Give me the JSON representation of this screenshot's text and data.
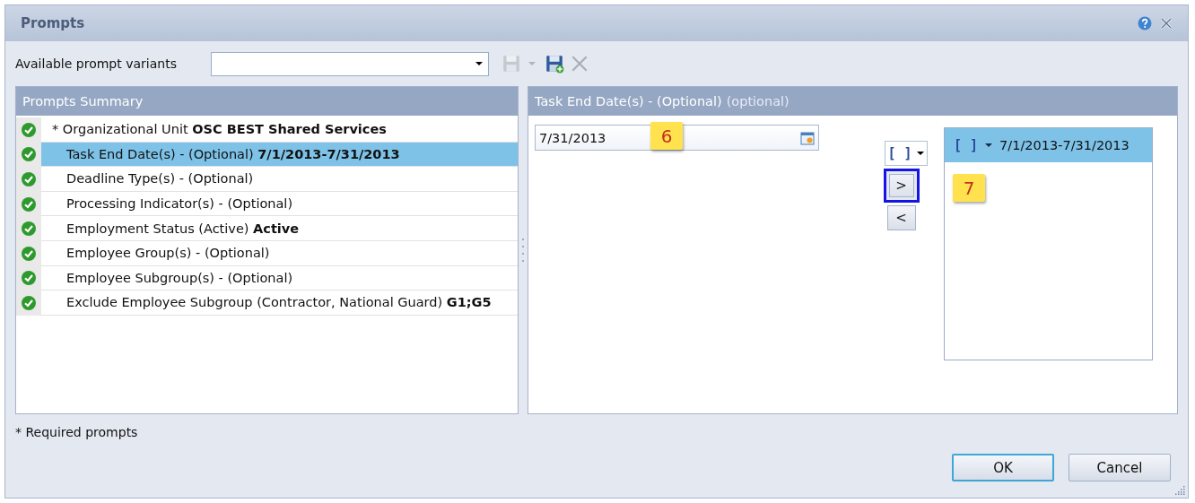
{
  "window": {
    "title": "Prompts"
  },
  "variants": {
    "label": "Available prompt variants"
  },
  "summary": {
    "title": "Prompts Summary",
    "rows": [
      {
        "text": "* Organizational Unit **OSC BEST Shared Services**",
        "selected": false,
        "indent": false
      },
      {
        "text": "Task End Date(s) - (Optional) **7/1/2013-7/31/2013**",
        "selected": true,
        "indent": true
      },
      {
        "text": "Deadline Type(s) - (Optional)",
        "selected": false,
        "indent": true
      },
      {
        "text": "Processing Indicator(s) - (Optional)",
        "selected": false,
        "indent": true
      },
      {
        "text": "Employment Status (Active) **Active**",
        "selected": false,
        "indent": true
      },
      {
        "text": "Employee Group(s) - (Optional)",
        "selected": false,
        "indent": true
      },
      {
        "text": "Employee Subgroup(s) - (Optional)",
        "selected": false,
        "indent": true
      },
      {
        "text": "Exclude Employee Subgroup (Contractor, National Guard) **G1;G5**",
        "selected": false,
        "indent": true
      }
    ]
  },
  "detail": {
    "title": "Task End Date(s) - (Optional)",
    "hint": "(optional)",
    "date_value": "7/31/2013",
    "operator": "[ ]",
    "move_buttons": [
      {
        "label": ">",
        "highlighted": true
      },
      {
        "label": "<",
        "highlighted": false
      }
    ],
    "values_header": {
      "operator": "[ ]",
      "text": "7/1/2013-7/31/2013"
    }
  },
  "callouts": [
    {
      "label": "6",
      "kind": "date"
    },
    {
      "label": "7",
      "kind": "list"
    }
  ],
  "footnote": "* Required prompts",
  "buttons": [
    {
      "label": "OK",
      "default": true
    },
    {
      "label": "Cancel",
      "default": false
    }
  ]
}
